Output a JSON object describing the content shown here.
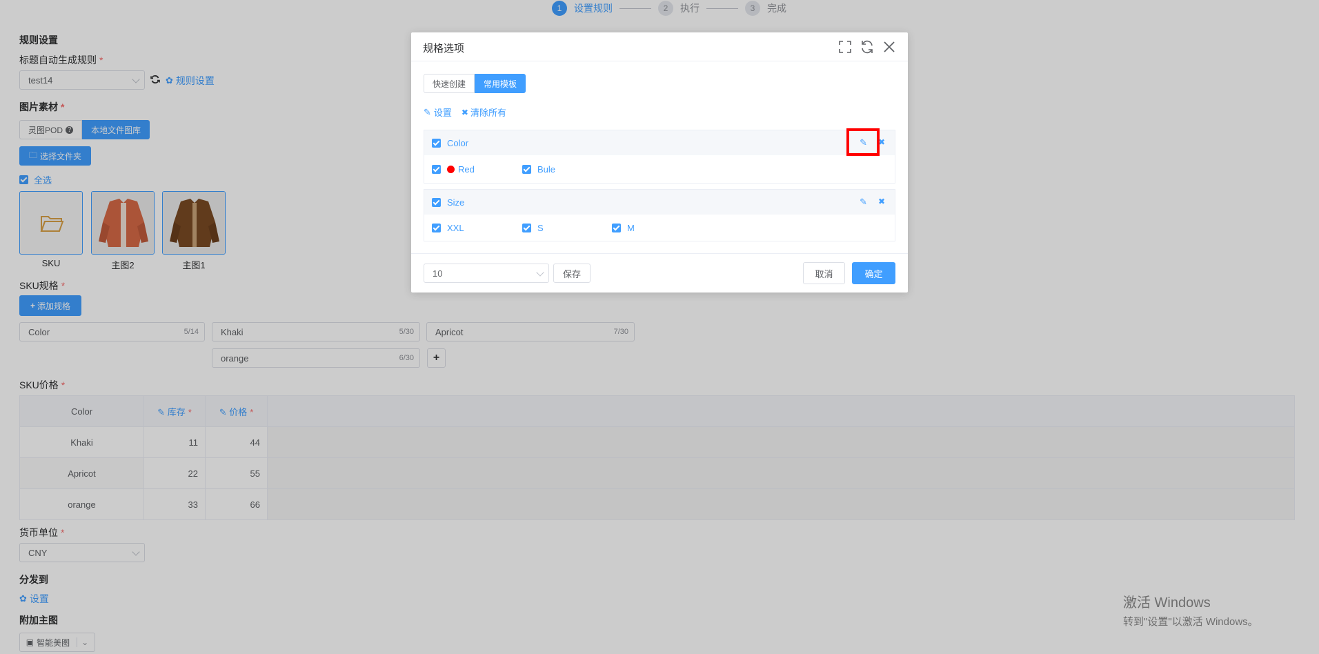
{
  "steps": [
    {
      "num": "1",
      "label": "设置规则"
    },
    {
      "num": "2",
      "label": "执行"
    },
    {
      "num": "3",
      "label": "完成"
    }
  ],
  "rules": {
    "section": "规则设置",
    "title_rule_label": "标题自动生成规则",
    "title_rule_value": "test14",
    "rule_settings_link": "规则设置"
  },
  "images": {
    "label": "图片素材",
    "tab_pod": "灵图POD",
    "tab_local": "本地文件图库",
    "select_folder": "选择文件夹",
    "select_all": "全选",
    "thumbs": [
      {
        "caption": "SKU"
      },
      {
        "caption": "主图2"
      },
      {
        "caption": "主图1"
      }
    ]
  },
  "sku_spec": {
    "label": "SKU规格",
    "add_button": "添加规格",
    "spec_name": {
      "value": "Color",
      "count": "5/14"
    },
    "values": [
      {
        "value": "Khaki",
        "count": "5/30"
      },
      {
        "value": "Apricot",
        "count": "7/30"
      },
      {
        "value": "orange",
        "count": "6/30"
      }
    ]
  },
  "sku_price": {
    "label": "SKU价格",
    "headers": [
      "Color",
      "库存",
      "价格"
    ],
    "rows": [
      {
        "color": "Khaki",
        "stock": "11",
        "price": "44"
      },
      {
        "color": "Apricot",
        "stock": "22",
        "price": "55"
      },
      {
        "color": "orange",
        "stock": "33",
        "price": "66"
      }
    ]
  },
  "currency": {
    "label": "货币单位",
    "value": "CNY"
  },
  "distribute": {
    "label": "分发到",
    "settings_link": "设置"
  },
  "extra_main": {
    "label": "附加主图",
    "button": "智能美图"
  },
  "watermark": {
    "line1": "激活 Windows",
    "line2": "转到\"设置\"以激活 Windows。"
  },
  "dialog": {
    "title": "规格选项",
    "tab_quick": "快速创建",
    "tab_template": "常用模板",
    "settings_link": "设置",
    "clear_link": "清除所有",
    "groups": [
      {
        "name": "Color",
        "options": [
          {
            "label": "Red",
            "color": "#ff0000"
          },
          {
            "label": "Bule"
          }
        ]
      },
      {
        "name": "Size",
        "options": [
          {
            "label": "XXL"
          },
          {
            "label": "S"
          },
          {
            "label": "M"
          }
        ]
      }
    ],
    "page_size": "10",
    "save_button": "保存",
    "cancel_button": "取消",
    "confirm_button": "确定"
  },
  "colors": {
    "primary": "#409eff",
    "required": "#f56c6c",
    "highlight": "#ff0000"
  }
}
